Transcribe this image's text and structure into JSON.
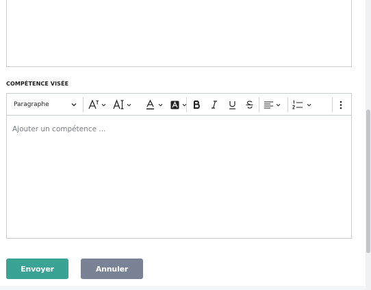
{
  "form": {
    "section_label": "COMPÉTENCE VISÉE",
    "editor": {
      "heading_select": "Paragraphe",
      "placeholder": "Ajouter un compétence ..."
    },
    "buttons": {
      "submit_label": "Envoyer",
      "cancel_label": "Annuler"
    }
  },
  "colors": {
    "submit_button": "#3aa394",
    "cancel_button": "#7a8295"
  },
  "icons": {
    "toolbar": [
      "font-size-icon",
      "line-height-icon",
      "font-color-icon",
      "background-color-icon",
      "bold-icon",
      "italic-icon",
      "underline-icon",
      "strikethrough-icon",
      "align-left-icon",
      "numbered-list-icon",
      "more-vertical-icon"
    ]
  }
}
